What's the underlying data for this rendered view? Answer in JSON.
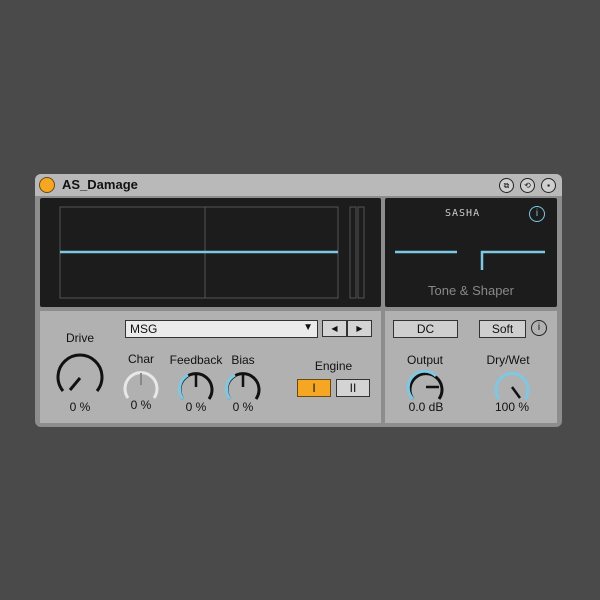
{
  "device": {
    "title": "AS_Damage"
  },
  "scope": {
    "brand_logo": "SASHA",
    "section_title": "Tone & Shaper"
  },
  "controls": {
    "preset_dropdown": {
      "selected": "MSG"
    },
    "drive": {
      "label": "Drive",
      "value": "0 %"
    },
    "char": {
      "label": "Char",
      "value": "0 %"
    },
    "feedback": {
      "label": "Feedback",
      "value": "0 %"
    },
    "bias": {
      "label": "Bias",
      "value": "0 %"
    },
    "engine": {
      "label": "Engine",
      "options": [
        "I",
        "II"
      ],
      "selected": "I"
    },
    "dc_button": "DC",
    "soft_button": "Soft",
    "output": {
      "label": "Output",
      "value": "0.0 dB"
    },
    "drywet": {
      "label": "Dry/Wet",
      "value": "100 %"
    }
  },
  "icons": {
    "prev": "◀",
    "next": "▶",
    "dropdown_arrow": "▼",
    "info": "i"
  },
  "colors": {
    "accent": "#f5a623",
    "trace": "#7ec8e3",
    "knob_active": "#7ec8e3"
  }
}
